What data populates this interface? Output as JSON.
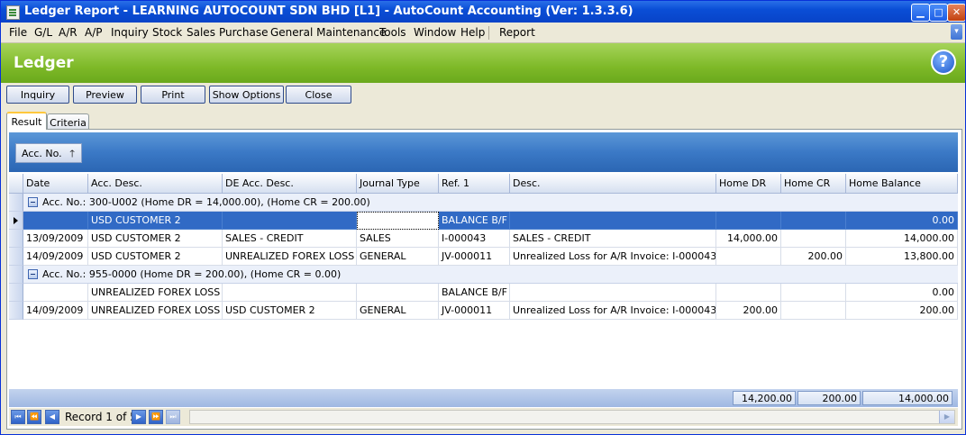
{
  "window": {
    "title": "Ledger Report - LEARNING AUTOCOUNT SDN BHD [L1] - AutoCount Accounting (Ver: 1.3.3.6)",
    "min_glyph": "▁",
    "max_glyph": "□",
    "close_glyph": "✕"
  },
  "menu": {
    "items": [
      "File",
      "G/L",
      "A/R",
      "A/P",
      "Inquiry",
      "Stock",
      "Sales",
      "Purchase",
      "General Maintenance",
      "Tools",
      "Window",
      "Help",
      "Report"
    ],
    "overflow_glyph": "▾"
  },
  "header": {
    "title": "Ledger",
    "help_glyph": "?"
  },
  "toolbar": {
    "buttons": [
      "Inquiry",
      "Preview",
      "Print",
      "Show Options",
      "Close"
    ]
  },
  "tabs": [
    "Result",
    "Criteria"
  ],
  "grouping": {
    "field": "Acc. No.",
    "sort_glyph": "🡑"
  },
  "columns": [
    "Date",
    "Acc. Desc.",
    "DE Acc. Desc.",
    "Journal Type",
    "Ref. 1",
    "Desc.",
    "Home DR",
    "Home CR",
    "Home Balance"
  ],
  "groups": [
    {
      "label": "Acc. No.: 300-U002 (Home DR = 14,000.00), (Home CR = 200.00)",
      "rows": [
        [
          "",
          "USD CUSTOMER 2",
          "",
          "",
          "BALANCE B/F",
          "",
          "",
          "",
          "0.00"
        ],
        [
          "13/09/2009",
          "USD CUSTOMER 2",
          "SALES - CREDIT",
          "SALES",
          "I-000043",
          "SALES - CREDIT",
          "14,000.00",
          "",
          "14,000.00"
        ],
        [
          "14/09/2009",
          "USD CUSTOMER 2",
          "UNREALIZED  FOREX LOSS",
          "GENERAL",
          "JV-000011",
          "Unrealized Loss for A/R Invoice: I-000043",
          "",
          "200.00",
          "13,800.00"
        ]
      ]
    },
    {
      "label": "Acc. No.: 955-0000 (Home DR = 200.00), (Home CR = 0.00)",
      "rows": [
        [
          "",
          "UNREALIZED  FOREX LOSS",
          "",
          "",
          "BALANCE B/F",
          "",
          "",
          "",
          "0.00"
        ],
        [
          "14/09/2009",
          "UNREALIZED  FOREX LOSS",
          "USD CUSTOMER 2",
          "GENERAL",
          "JV-000011",
          "Unrealized Loss for A/R Invoice: I-000043",
          "200.00",
          "",
          "200.00"
        ]
      ]
    }
  ],
  "totals": {
    "home_dr": "14,200.00",
    "home_cr": "200.00",
    "home_balance": "14,000.00"
  },
  "navigator": {
    "record_text": "Record 1 of 5",
    "first_glyph": "⏮",
    "prev_page_glyph": "⏪",
    "prev_glyph": "◀",
    "next_glyph": "▶",
    "next_page_glyph": "⏩",
    "last_glyph": "⏭",
    "scroll_right_glyph": "▶"
  }
}
